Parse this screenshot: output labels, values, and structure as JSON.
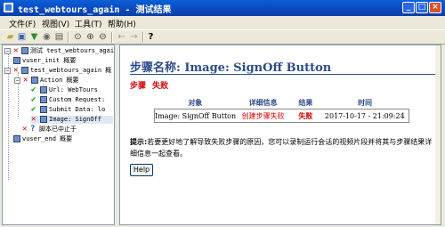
{
  "window": {
    "title": "test_webtours_again - 测试结果",
    "minimize": "_",
    "maximize": "□",
    "close": "×"
  },
  "menu": [
    "文件(F)",
    "视图(V)",
    "工具(T)",
    "帮助(H)"
  ],
  "toolbar_icons": [
    "open-icon",
    "save-icon",
    "filter-icon",
    "find-icon",
    "print-icon",
    "zoom-icon",
    "zoom-in-icon",
    "zoom-out-icon",
    "back-icon",
    "forward-icon",
    "help-icon"
  ],
  "tree": {
    "root": "测试 test_webtours_again",
    "n1": "vuser_init 概要",
    "n2": "test_webtours_again 概",
    "n3": "Action 概要",
    "n4": "Url: WebTours",
    "n5": "Custom Request:",
    "n6": "Submit Data: lo",
    "n7": "Image: SignOff",
    "n8": "脚本已中止于",
    "n9": "vuser_end 概要"
  },
  "detail": {
    "step_title": "步骤名称: Image: SignOff Button",
    "status_label": "步骤",
    "status_value": "失败",
    "table": {
      "headers": [
        "对象",
        "详细信息",
        "结果",
        "时间"
      ],
      "rows": [
        [
          "Image: SignOff Button",
          "创建步骤失败",
          "失败",
          "2017-10-17 - 21:09:24"
        ]
      ]
    },
    "tip_label": "提示:",
    "tip_text": "若要更好地了解导致失败步骤的原因，您可以录制运行会话的视频片段并将其与步骤结果详细信息一起查看。",
    "help_button": "Help"
  },
  "colors": {
    "title_blue": "#0B4ABF",
    "heading_blue": "#2b4b8b",
    "fail_red": "#d20000",
    "pass_green": "#0a9a0a"
  }
}
